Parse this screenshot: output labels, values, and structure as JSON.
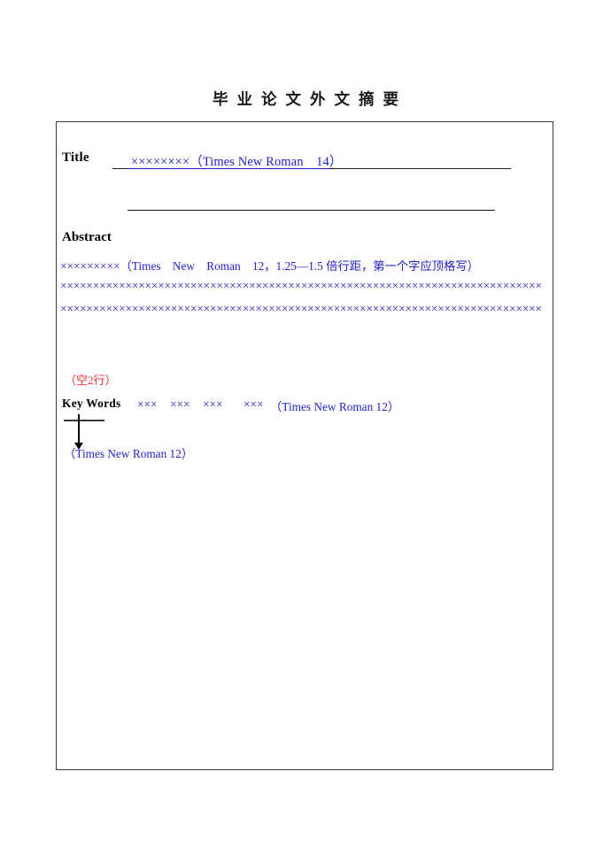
{
  "page": {
    "heading": "毕业论文外文摘要"
  },
  "form": {
    "title_field": {
      "label": "Title",
      "value": "××××××××（Times New Roman　14）"
    },
    "abstract": {
      "label": "Abstract",
      "line_1": "×××××××××（Times　New　Roman　12，1.25—1.5 倍行距，第一个字应顶格写）",
      "line_2": "××××××××××××××××××××××××××××××××××××××××××××××××××××××××××××××××××××××××××",
      "line_3": "××××××××××××××××××××××××××××××××××××××××××××××××××××××××××××××××××××××××××"
    },
    "blank_lines_note": "（空2行）",
    "keywords": {
      "label": "Key Words",
      "terms": [
        "×××",
        "×××",
        "×××",
        "×××"
      ],
      "font_note": "（Times New Roman 12）"
    },
    "annotation": {
      "arrow_target_note": "（Times New Roman 12）"
    }
  },
  "colors": {
    "placeholder_blue": "#2222cc",
    "annotation_red": "#ff3333",
    "border_gray": "#3a3a3a",
    "text_black": "#000000"
  }
}
